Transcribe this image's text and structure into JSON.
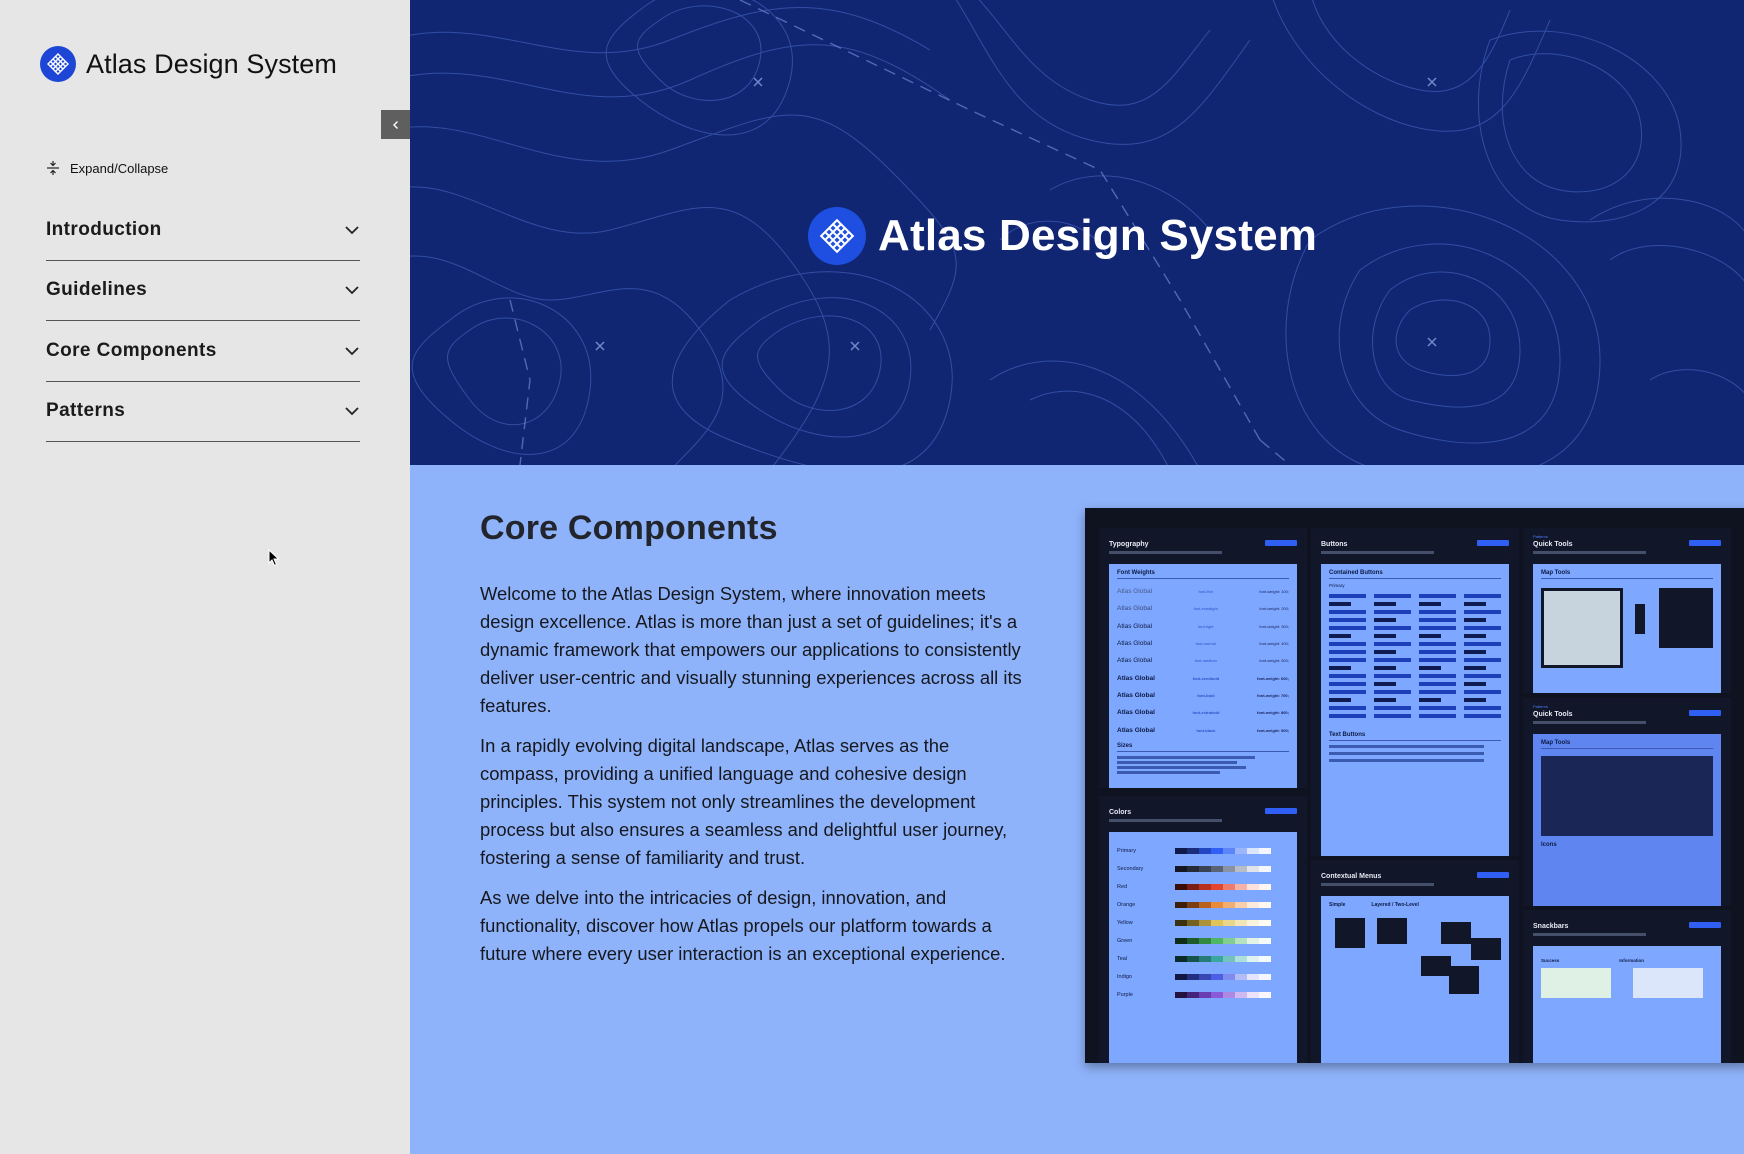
{
  "sidebar": {
    "brand_title": "Atlas Design System",
    "expand_label": "Expand/Collapse",
    "items": [
      {
        "label": "Introduction"
      },
      {
        "label": "Guidelines"
      },
      {
        "label": "Core Components"
      },
      {
        "label": "Patterns"
      }
    ]
  },
  "hero": {
    "title": "Atlas Design System"
  },
  "section": {
    "title": "Core Components",
    "paragraphs": [
      "Welcome to the Atlas Design System, where innovation meets design excellence. Atlas is more than just a set of guidelines; it's a dynamic framework that empowers our applications to consistently deliver user-centric and visually stunning experiences across all its features.",
      "In a rapidly evolving digital landscape, Atlas serves as the compass, providing a unified language and cohesive design principles. This system not only streamlines the development process but also ensures a seamless and delightful user journey, fostering a sense of familiarity and trust.",
      "As we delve into the intricacies of design, innovation, and functionality, discover how Atlas propels our platform towards a future where every user interaction is an exceptional experience."
    ]
  },
  "preview": {
    "typography": {
      "title": "Typography",
      "label": "Font Weights",
      "sample": "Atlas Global",
      "sizes_label": "Sizes",
      "weights": [
        {
          "name": "font-thin",
          "value": "font-weight: 100;"
        },
        {
          "name": "font-extralight",
          "value": "font-weight: 200;"
        },
        {
          "name": "font-light",
          "value": "font-weight: 300;"
        },
        {
          "name": "font-normal",
          "value": "font-weight: 400;"
        },
        {
          "name": "font-medium",
          "value": "font-weight: 500;"
        },
        {
          "name": "font-semibold",
          "value": "font-weight: 600;"
        },
        {
          "name": "font-bold",
          "value": "font-weight: 700;"
        },
        {
          "name": "font-extrabold",
          "value": "font-weight: 800;"
        },
        {
          "name": "font-black",
          "value": "font-weight: 900;"
        }
      ]
    },
    "buttons": {
      "title": "Buttons",
      "label": "Contained Buttons",
      "sub_label": "Primary",
      "text_label": "Text Buttons"
    },
    "quick_tools_1": {
      "crumb": "Patterns",
      "title": "Quick Tools",
      "label": "Map Tools"
    },
    "quick_tools_2": {
      "crumb": "Patterns",
      "title": "Quick Tools",
      "label": "Map Tools",
      "icons_label": "Icons"
    },
    "colors": {
      "title": "Colors",
      "rows": [
        {
          "name": "Primary",
          "color": "#2f5ff5"
        },
        {
          "name": "Secondary",
          "color": "#5a6275"
        },
        {
          "name": "Red",
          "color": "#e2462f"
        },
        {
          "name": "Orange",
          "color": "#e98b3a"
        },
        {
          "name": "Yellow",
          "color": "#e0c45a"
        },
        {
          "name": "Green",
          "color": "#4fb663"
        },
        {
          "name": "Teal",
          "color": "#3aa6a0"
        },
        {
          "name": "Indigo",
          "color": "#4c5ee6"
        },
        {
          "name": "Purple",
          "color": "#8b5ad8"
        }
      ]
    },
    "context_menus": {
      "title": "Contextual Menus",
      "labels": [
        "Simple",
        "Layered / Two-Level"
      ]
    },
    "snackbars": {
      "title": "Snackbars",
      "labels": [
        "Success",
        "Information"
      ]
    }
  },
  "colors": {
    "hero_bg": "#102673",
    "content_bg": "#8fb3fb",
    "sidebar_bg": "#e6e6e6",
    "brand_blue": "#1d46d6"
  }
}
